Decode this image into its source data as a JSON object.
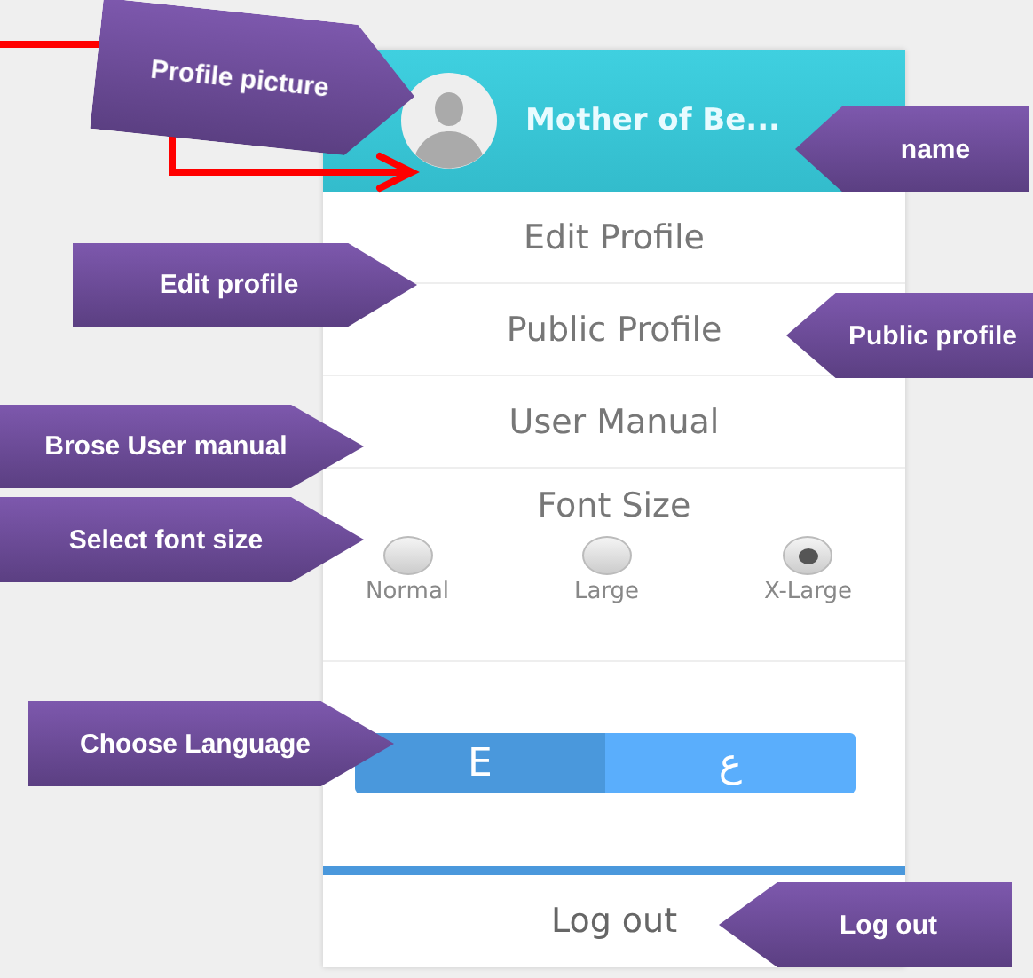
{
  "header": {
    "name": "Mother of Be..."
  },
  "menu_items": [
    "Edit Profile",
    "Public Profile",
    "User Manual"
  ],
  "font_size": {
    "title": "Font Size",
    "options": [
      {
        "label": "Normal",
        "selected": false
      },
      {
        "label": "Large",
        "selected": false
      },
      {
        "label": "X-Large",
        "selected": true
      }
    ]
  },
  "language": [
    {
      "label": "E",
      "selected": true
    },
    {
      "label": "ع",
      "selected": false
    }
  ],
  "logout": "Log out",
  "callouts": [
    {
      "text": "Profile picture",
      "kind": "right"
    },
    {
      "text": "name",
      "kind": "left"
    },
    {
      "text": "Edit profile",
      "kind": "right"
    },
    {
      "text": "Public profile",
      "kind": "left"
    },
    {
      "text": "Brose User manual",
      "kind": "right"
    },
    {
      "text": "Select font size",
      "kind": "right"
    },
    {
      "text": "Choose Language",
      "kind": "right"
    },
    {
      "text": "Log out",
      "kind": "left"
    }
  ]
}
